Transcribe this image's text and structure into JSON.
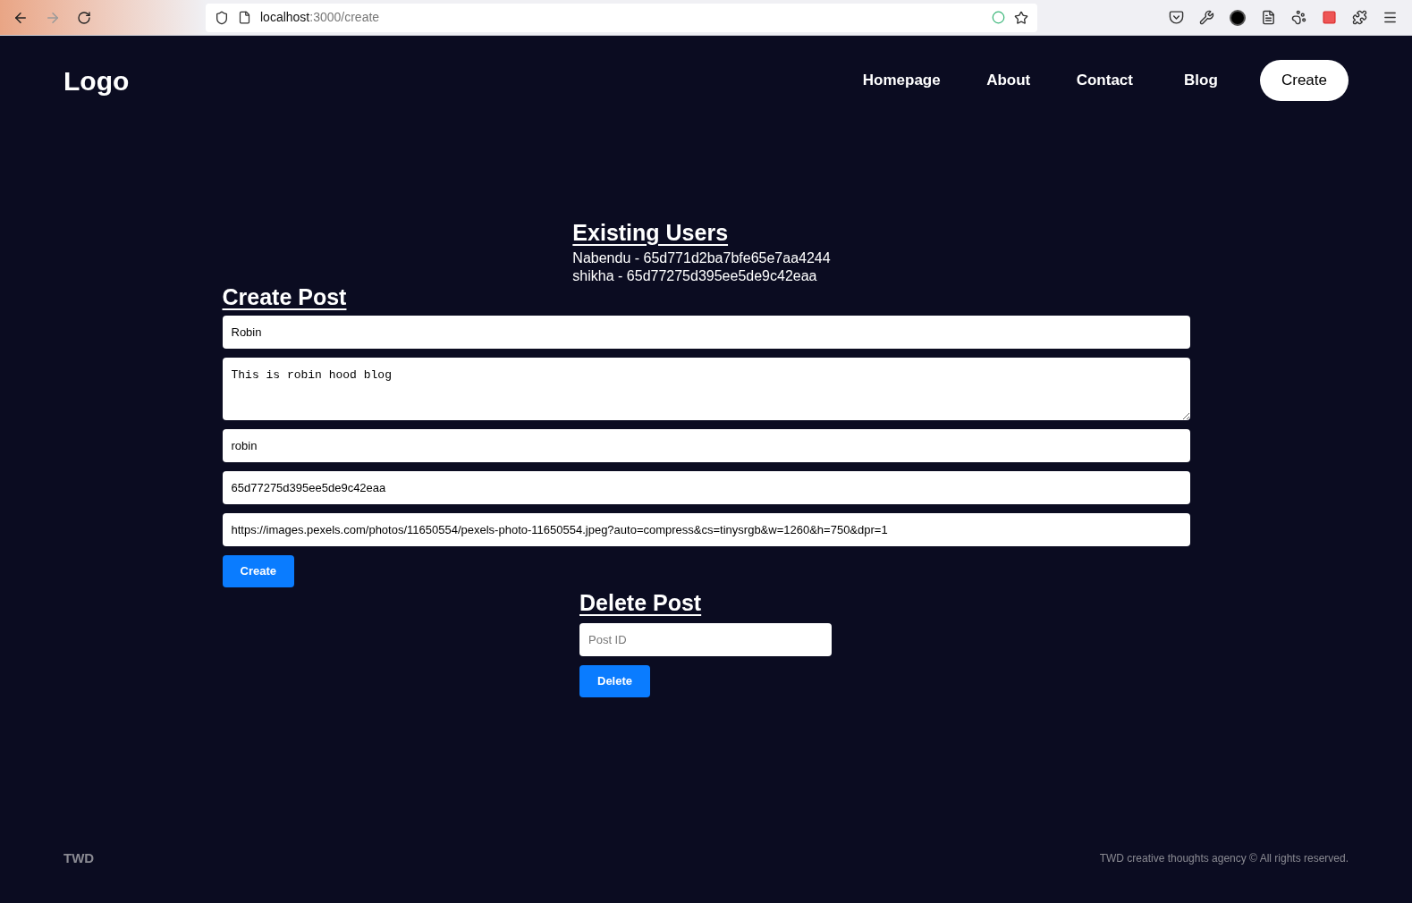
{
  "browser": {
    "url_host": "localhost",
    "url_path": ":3000/create",
    "forward_disabled": true
  },
  "header": {
    "logo": "Logo",
    "nav": [
      {
        "label": "Homepage",
        "selected": false
      },
      {
        "label": "About",
        "selected": false
      },
      {
        "label": "Contact",
        "selected": false
      },
      {
        "label": "Blog",
        "selected": false
      },
      {
        "label": "Create",
        "selected": true
      }
    ]
  },
  "users": {
    "title": "Existing Users",
    "items": [
      "Nabendu - 65d771d2ba7bfe65e7aa4244",
      "shikha - 65d77275d395ee5de9c42eaa"
    ]
  },
  "create_post": {
    "title": "Create Post",
    "fields": [
      {
        "kind": "input",
        "value": "Robin"
      },
      {
        "kind": "textarea",
        "value": "This is robin hood blog"
      },
      {
        "kind": "input",
        "value": "robin"
      },
      {
        "kind": "input",
        "value": "65d77275d395ee5de9c42eaa"
      },
      {
        "kind": "input",
        "value": "https://images.pexels.com/photos/11650554/pexels-photo-11650554.jpeg?auto=compress&cs=tinysrgb&w=1260&h=750&dpr=1"
      }
    ],
    "button": "Create"
  },
  "delete_post": {
    "title": "Delete Post",
    "placeholder": "Post ID",
    "button": "Delete"
  },
  "footer": {
    "brand": "TWD",
    "copyright": "TWD creative thoughts agency © All rights reserved."
  }
}
